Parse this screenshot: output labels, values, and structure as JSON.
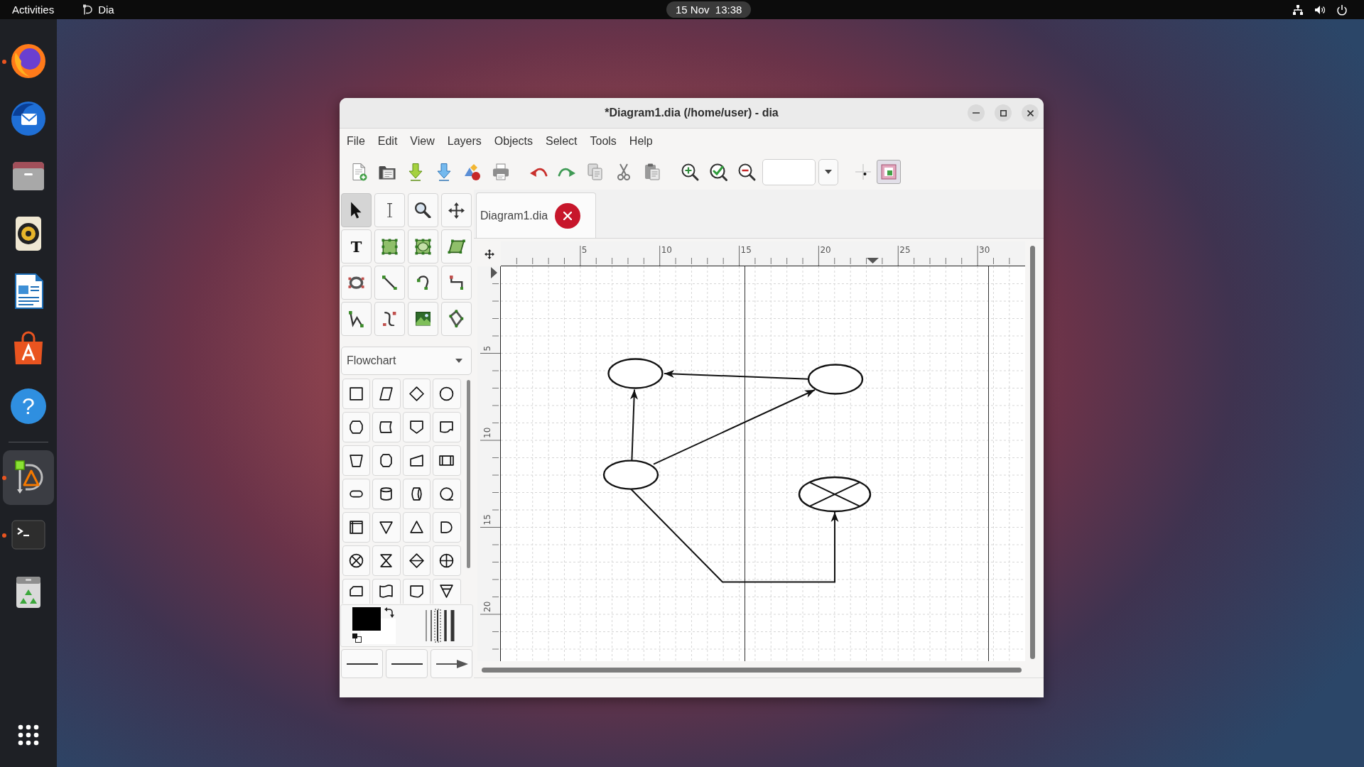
{
  "top_bar": {
    "activities": "Activities",
    "app": {
      "name": "Dia"
    },
    "clock": "15 Nov  13:38"
  },
  "dock": {
    "groups": [
      [
        {
          "kind": "browser",
          "running": true,
          "selected": false
        },
        {
          "kind": "mail",
          "running": false,
          "selected": false
        },
        {
          "kind": "files",
          "running": false,
          "selected": false
        },
        {
          "kind": "music",
          "running": false,
          "selected": false
        },
        {
          "kind": "writer",
          "running": false,
          "selected": false
        },
        {
          "kind": "software",
          "running": false,
          "selected": false
        },
        {
          "kind": "help",
          "glyph": "?",
          "running": false,
          "selected": false
        }
      ],
      [
        {
          "kind": "diagram",
          "running": true,
          "selected": true
        },
        {
          "kind": "terminal",
          "running": true,
          "selected": false
        },
        {
          "kind": "trash",
          "running": false,
          "selected": false
        }
      ]
    ]
  },
  "window": {
    "title": "*Diagram1.dia (/home/user) - dia",
    "menu": [
      "File",
      "Edit",
      "View",
      "Layers",
      "Objects",
      "Select",
      "Tools",
      "Help"
    ],
    "toolbar": {
      "groups": [
        [
          {
            "kind": "new"
          },
          {
            "kind": "open"
          },
          {
            "kind": "save"
          },
          {
            "kind": "save-as"
          },
          {
            "kind": "export"
          },
          {
            "kind": "print"
          }
        ],
        [
          {
            "kind": "undo"
          },
          {
            "kind": "redo"
          },
          {
            "kind": "copy"
          },
          {
            "kind": "cut"
          },
          {
            "kind": "paste"
          }
        ],
        [
          {
            "kind": "zoom-in"
          },
          {
            "kind": "zoom-fit"
          },
          {
            "kind": "zoom-out"
          }
        ]
      ],
      "toggles": [
        {
          "kind": "snap-grid",
          "on": false
        },
        {
          "kind": "snap-objects",
          "on": true
        }
      ]
    },
    "toolbox": {
      "tools": [
        {
          "kind": "pointer",
          "selected": true
        },
        {
          "kind": "text-edit",
          "selected": false
        },
        {
          "kind": "magnify",
          "selected": false
        },
        {
          "kind": "scroll",
          "selected": false
        },
        {
          "kind": "text",
          "glyph": "T",
          "selected": false
        },
        {
          "kind": "box",
          "selected": false
        },
        {
          "kind": "ellipse",
          "selected": false
        },
        {
          "kind": "polygon",
          "selected": false
        },
        {
          "kind": "beziergon",
          "selected": false
        },
        {
          "kind": "line",
          "selected": false
        },
        {
          "kind": "arc",
          "selected": false
        },
        {
          "kind": "zigzag",
          "selected": false
        },
        {
          "kind": "polyline",
          "selected": false
        },
        {
          "kind": "bezier",
          "selected": false
        },
        {
          "kind": "image",
          "selected": false
        },
        {
          "kind": "outline",
          "selected": false
        }
      ],
      "sheet": "Flowchart",
      "shapes": [
        {
          "kind": "square"
        },
        {
          "kind": "parallelogram"
        },
        {
          "kind": "diamond"
        },
        {
          "kind": "circle"
        },
        {
          "kind": "hexagon"
        },
        {
          "kind": "curved-box"
        },
        {
          "kind": "pentagon"
        },
        {
          "kind": "wavy-box"
        },
        {
          "kind": "trapezoid"
        },
        {
          "kind": "octagon"
        },
        {
          "kind": "slanted-box"
        },
        {
          "kind": "striped-box"
        },
        {
          "kind": "stadium"
        },
        {
          "kind": "cylinder"
        },
        {
          "kind": "side-cylinder"
        },
        {
          "kind": "tailed-circle"
        },
        {
          "kind": "lined-box"
        },
        {
          "kind": "down-triangle"
        },
        {
          "kind": "up-triangle"
        },
        {
          "kind": "half-round"
        },
        {
          "kind": "crossed-circle"
        },
        {
          "kind": "hourglass"
        },
        {
          "kind": "split-diamond"
        },
        {
          "kind": "plus-circle"
        },
        {
          "kind": "cut-box"
        },
        {
          "kind": "wavy-band"
        },
        {
          "kind": "curl-box"
        },
        {
          "kind": "barred-triangle"
        }
      ],
      "line_buttons": [
        {
          "kind": "start"
        },
        {
          "kind": "style"
        },
        {
          "kind": "end"
        }
      ]
    },
    "tabs": [
      {
        "label": "Diagram1.dia",
        "selected": true
      }
    ],
    "rulers": {
      "horizontal": [
        "5",
        "10",
        "15",
        "20",
        "25",
        "30"
      ],
      "vertical": [
        "5",
        "10",
        "15",
        "20"
      ]
    },
    "diagram": {
      "shapes": [
        {
          "kind": "ellipse"
        },
        {
          "kind": "ellipse"
        },
        {
          "kind": "ellipse"
        },
        {
          "kind": "crossed-ellipse"
        }
      ]
    }
  }
}
